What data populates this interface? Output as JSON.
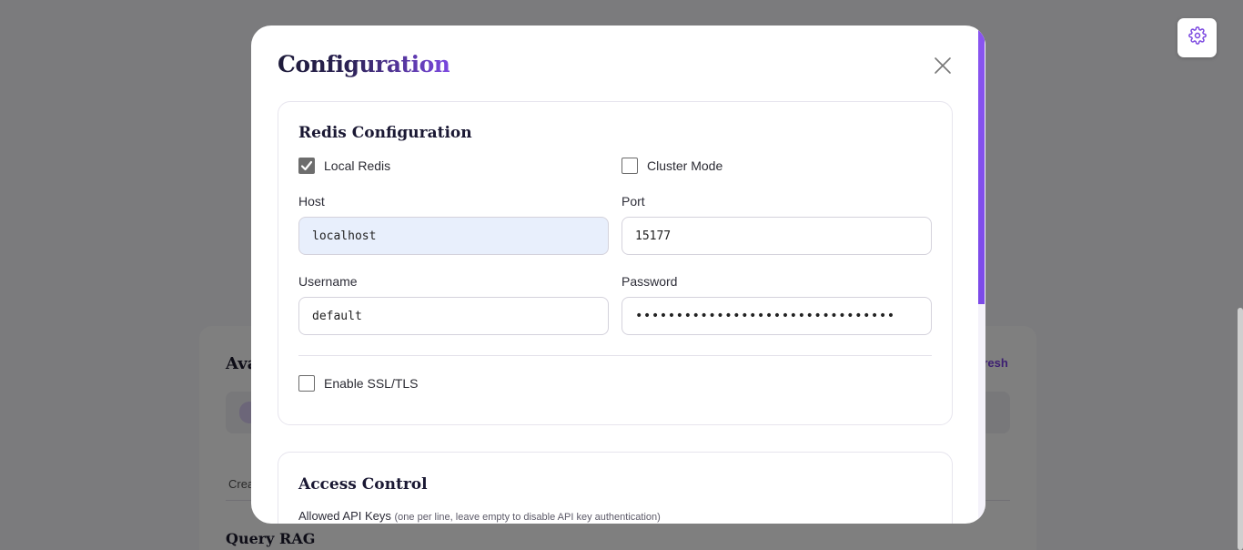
{
  "background": {
    "heading": "Ava",
    "refresh_label": "fresh",
    "pill_label": "C",
    "column_header": "Crea",
    "query_heading": "Query RAG"
  },
  "settings_icon": "gear-icon",
  "modal": {
    "title": "Configuration",
    "close_icon": "close-icon",
    "redis": {
      "title": "Redis Configuration",
      "local_redis": {
        "label": "Local Redis",
        "checked": true
      },
      "cluster_mode": {
        "label": "Cluster Mode",
        "checked": false
      },
      "host": {
        "label": "Host",
        "value": "localhost"
      },
      "port": {
        "label": "Port",
        "value": "15177"
      },
      "username": {
        "label": "Username",
        "value": "default"
      },
      "password": {
        "label": "Password",
        "value": "••••••••••••••••••••••••••••••••"
      },
      "ssl": {
        "label": "Enable SSL/TLS",
        "checked": false
      }
    },
    "access": {
      "title": "Access Control",
      "api_keys_label": "Allowed API Keys",
      "api_keys_hint": "(one per line, leave empty to disable API key authentication)"
    }
  },
  "colors": {
    "accent": "#7b48e0",
    "overlay": "rgba(0,0,0,0.5)",
    "autofill": "#e8effc"
  }
}
